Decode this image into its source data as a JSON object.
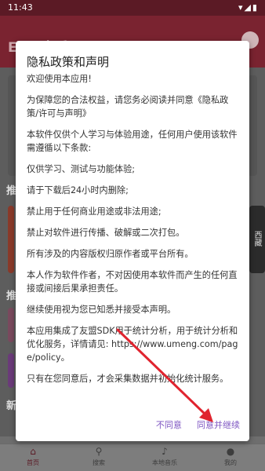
{
  "status": {
    "time": "11:43"
  },
  "app": {
    "title": "EMO音乐"
  },
  "background": {
    "labels": [
      "推",
      "推",
      "新"
    ],
    "cover_text": "西藏"
  },
  "nav": [
    {
      "label": "首页",
      "icon": "⌂"
    },
    {
      "label": "搜索",
      "icon": "⚲"
    },
    {
      "label": "本地音乐",
      "icon": "♪"
    },
    {
      "label": "我的",
      "icon": "●"
    }
  ],
  "dialog": {
    "title": "隐私政策和声明",
    "paragraphs": [
      "欢迎使用本应用!",
      "为保障您的合法权益，请您务必阅读并同意《隐私政策/许可与声明》",
      "本软件仅供个人学习与体验用途，任何用户使用该软件需遵循以下条款:",
      "仅供学习、测试与功能体验;",
      "请于下载后24小时内删除;",
      "禁止用于任何商业用途或非法用途;",
      "禁止对软件进行传播、破解或二次打包。",
      "所有涉及的内容版权归原作者或平台所有。",
      "本人作为软件作者，不对因使用本软件而产生的任何直接或间接后果承担责任。",
      "继续使用视为您已知悉并接受本声明。",
      "本应用集成了友盟SDK用于统计分析，用于统计分析和优化服务，详情请见: https://www.umeng.com/page/policy。",
      "只有在您同意后，才会采集数据并初始化统计服务。"
    ],
    "decline_label": "不同意",
    "accept_label": "同意并继续"
  },
  "colors": {
    "accent": "#7e56c2",
    "app_bar": "#7a2330",
    "arrow": "#e0242f"
  }
}
